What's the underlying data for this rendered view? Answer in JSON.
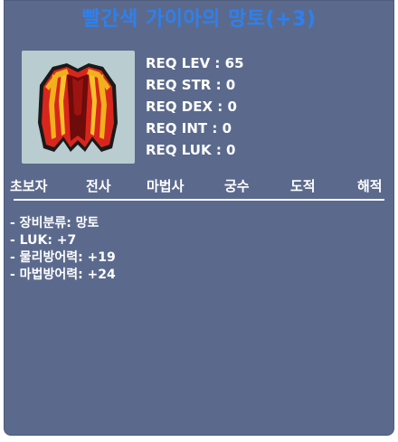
{
  "item": {
    "name": "빨간색 가이아의 망토(+3)",
    "icon": "red-cape-icon"
  },
  "requirements": [
    {
      "label": "REQ LEV : 65"
    },
    {
      "label": "REQ STR : 0"
    },
    {
      "label": "REQ DEX : 0"
    },
    {
      "label": "REQ INT : 0"
    },
    {
      "label": "REQ LUK : 0"
    }
  ],
  "jobs": [
    "초보자",
    "전사",
    "마법사",
    "궁수",
    "도적",
    "해적"
  ],
  "stats": [
    "- 장비분류: 망토",
    "- LUK: +7",
    "- 물리방어력: +19",
    "- 마법방어력: +24"
  ],
  "colors": {
    "title": "#2e80ee",
    "panel": "#5b6a8c",
    "icon_background": "#b9cccf"
  }
}
